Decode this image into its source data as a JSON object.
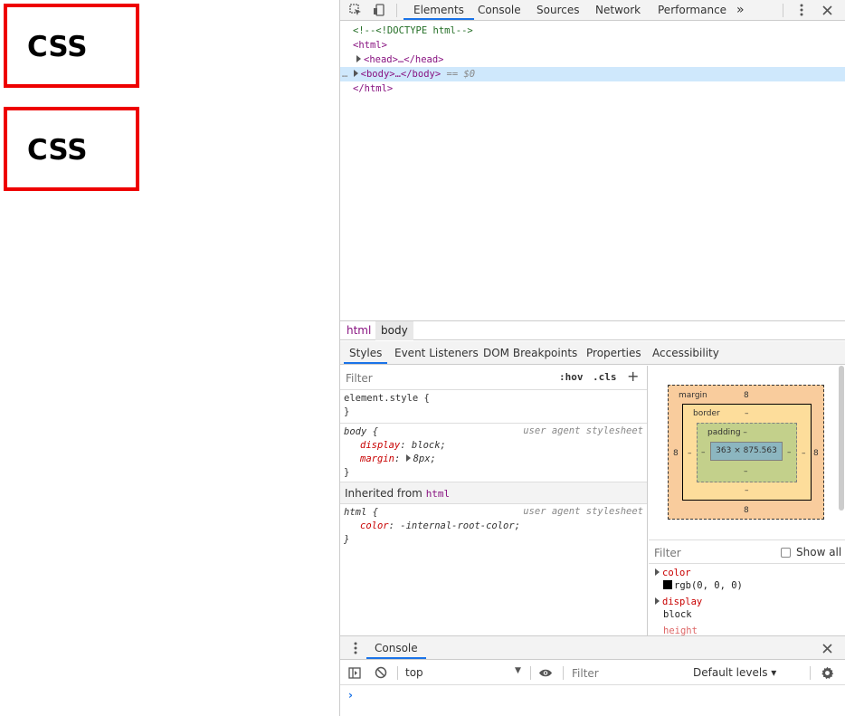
{
  "page": {
    "boxes": [
      {
        "text": "CSS"
      },
      {
        "text": "CSS"
      }
    ]
  },
  "devtools": {
    "tabs": [
      "Elements",
      "Console",
      "Sources",
      "Network",
      "Performance"
    ],
    "more_tabs_glyph": "»",
    "tree": {
      "comment": "<!--<!DOCTYPE html-->",
      "html_open": "<html>",
      "head": "<head>…</head>",
      "body": "<body>…</body>",
      "body_marker": "== $0",
      "html_close": "</html>",
      "dots": "…"
    },
    "breadcrumbs": [
      "html",
      "body"
    ],
    "subtabs": [
      "Styles",
      "Event Listeners",
      "DOM Breakpoints",
      "Properties",
      "Accessibility"
    ],
    "styles": {
      "filter_placeholder": "Filter",
      "hov": ":hov",
      "cls": ".cls",
      "plus": "+",
      "element_style": "element.style {",
      "close": "}",
      "body_rule": {
        "selector": "body {",
        "source": "user agent stylesheet",
        "p1_name": "display",
        "p1_value": "block;",
        "p2_name": "margin",
        "p2_value": "8px;"
      },
      "inherited_label": "Inherited from",
      "inherited_tag": "html",
      "html_rule": {
        "selector": "html {",
        "source": "user agent stylesheet",
        "p1_name": "color",
        "p1_value": "-internal-root-color;"
      }
    },
    "box_model": {
      "margin_label": "margin",
      "margin_top": "8",
      "margin_bottom": "8",
      "margin_left": "8",
      "margin_right": "8",
      "border_label": "border",
      "border_top": "–",
      "border_bottom": "–",
      "border_left": "–",
      "border_right": "–",
      "padding_label": "padding –",
      "padding_bottom": "–",
      "padding_left": "–",
      "padding_right": "–",
      "content": "363 × 875.563"
    },
    "computed": {
      "filter_placeholder": "Filter",
      "show_all": "Show all",
      "props": [
        {
          "name": "color",
          "value": "rgb(0, 0, 0)"
        },
        {
          "name": "display",
          "value": "block"
        },
        {
          "name": "height",
          "value": ""
        }
      ]
    },
    "console": {
      "tab": "Console",
      "context": "top",
      "filter_placeholder": "Filter",
      "levels": "Default levels ▾",
      "prompt": "›"
    }
  },
  "colors": {
    "accent": "#1a73e8",
    "box_border": "#ee0000",
    "tag": "#881280",
    "comment": "#236e25",
    "property": "#c80000"
  }
}
